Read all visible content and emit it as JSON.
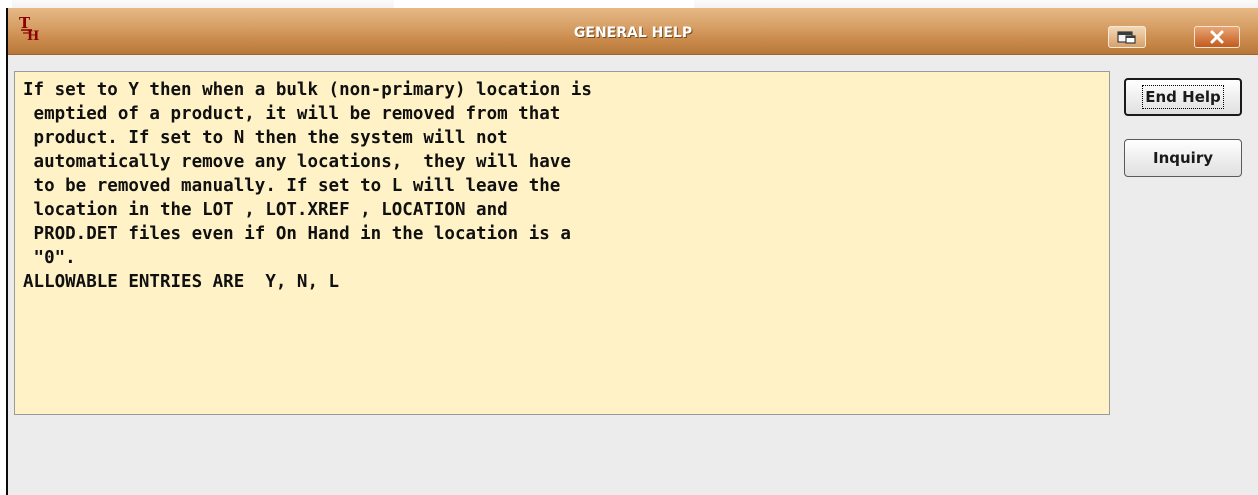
{
  "window": {
    "title": "GENERAL HELP",
    "icon": "app-logo-icon",
    "title_color": "#ffffff",
    "titlebar_color": "#d9a36a"
  },
  "titlebar_buttons": {
    "restore_icon": "restore-icon",
    "close_icon": "close-icon",
    "close_label": "✕"
  },
  "help_text": {
    "background": "#fff2c6",
    "lines": [
      "If set to Y then when a bulk (non-primary) location is",
      " emptied of a product, it will be removed from that",
      " product. If set to N then the system will not",
      " automatically remove any locations,  they will have",
      " to be removed manually. If set to L will leave the",
      " location in the LOT , LOT.XREF , LOCATION and",
      " PROD.DET files even if On Hand in the location is a",
      " \"0\".",
      "ALLOWABLE ENTRIES ARE  Y, N, L"
    ]
  },
  "buttons": {
    "end_help": "End Help",
    "inquiry": "Inquiry"
  }
}
